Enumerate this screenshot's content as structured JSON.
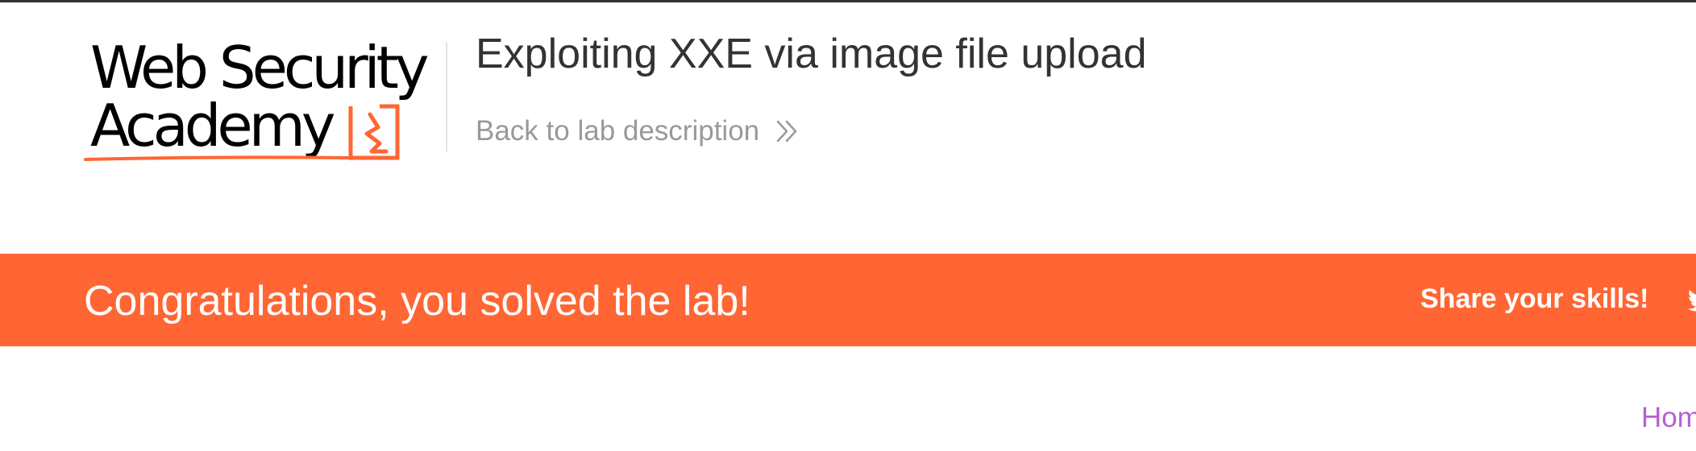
{
  "brand": {
    "logo_line1": "Web Security",
    "logo_line2": "Academy",
    "logo_mark_icon": "flask-lightning-icon",
    "accent_color": "#ff6633"
  },
  "header": {
    "lab_title": "Exploiting XXE via image file upload",
    "back_link_label": "Back to lab description",
    "back_link_icon": "double-chevron-right-icon"
  },
  "banner": {
    "message": "Congratulations, you solved the lab!",
    "share_label": "Share your skills!",
    "share_icon": "twitter-icon",
    "background_color": "#ff6633"
  },
  "nav": {
    "home_label": "Home",
    "link_color": "#b55fd1"
  }
}
